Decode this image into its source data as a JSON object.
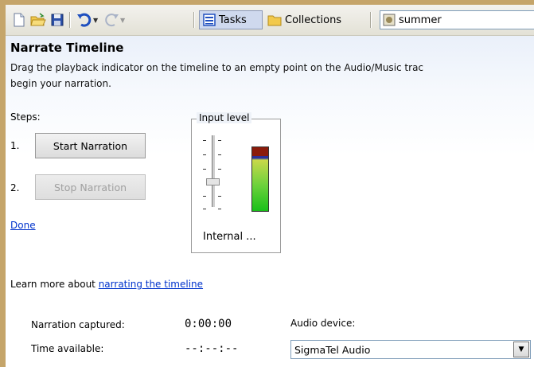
{
  "toolbar": {
    "tasks_label": "Tasks",
    "collections_label": "Collections",
    "search_value": "summer"
  },
  "panel": {
    "title": "Narrate Timeline",
    "description_line1": "Drag the playback indicator on the timeline to an empty point on the Audio/Music trac",
    "description_line2": "begin your narration.",
    "steps_label": "Steps:",
    "step1_num": "1.",
    "step1_button": "Start Narration",
    "step2_num": "2.",
    "step2_button": "Stop Narration",
    "done_link": "Done",
    "input_level_caption": "Input level",
    "input_device_label": "Internal ...",
    "input_level_fraction": 0.86,
    "learn_prefix": "Learn more about ",
    "learn_link": "narrating the timeline",
    "narration_captured_label": "Narration captured:",
    "narration_captured_value": "0:00:00",
    "time_available_label": "Time available:",
    "time_available_value": "--:--:--",
    "audio_device_label": "Audio device:",
    "audio_device_value": "SigmaTel Audio"
  }
}
